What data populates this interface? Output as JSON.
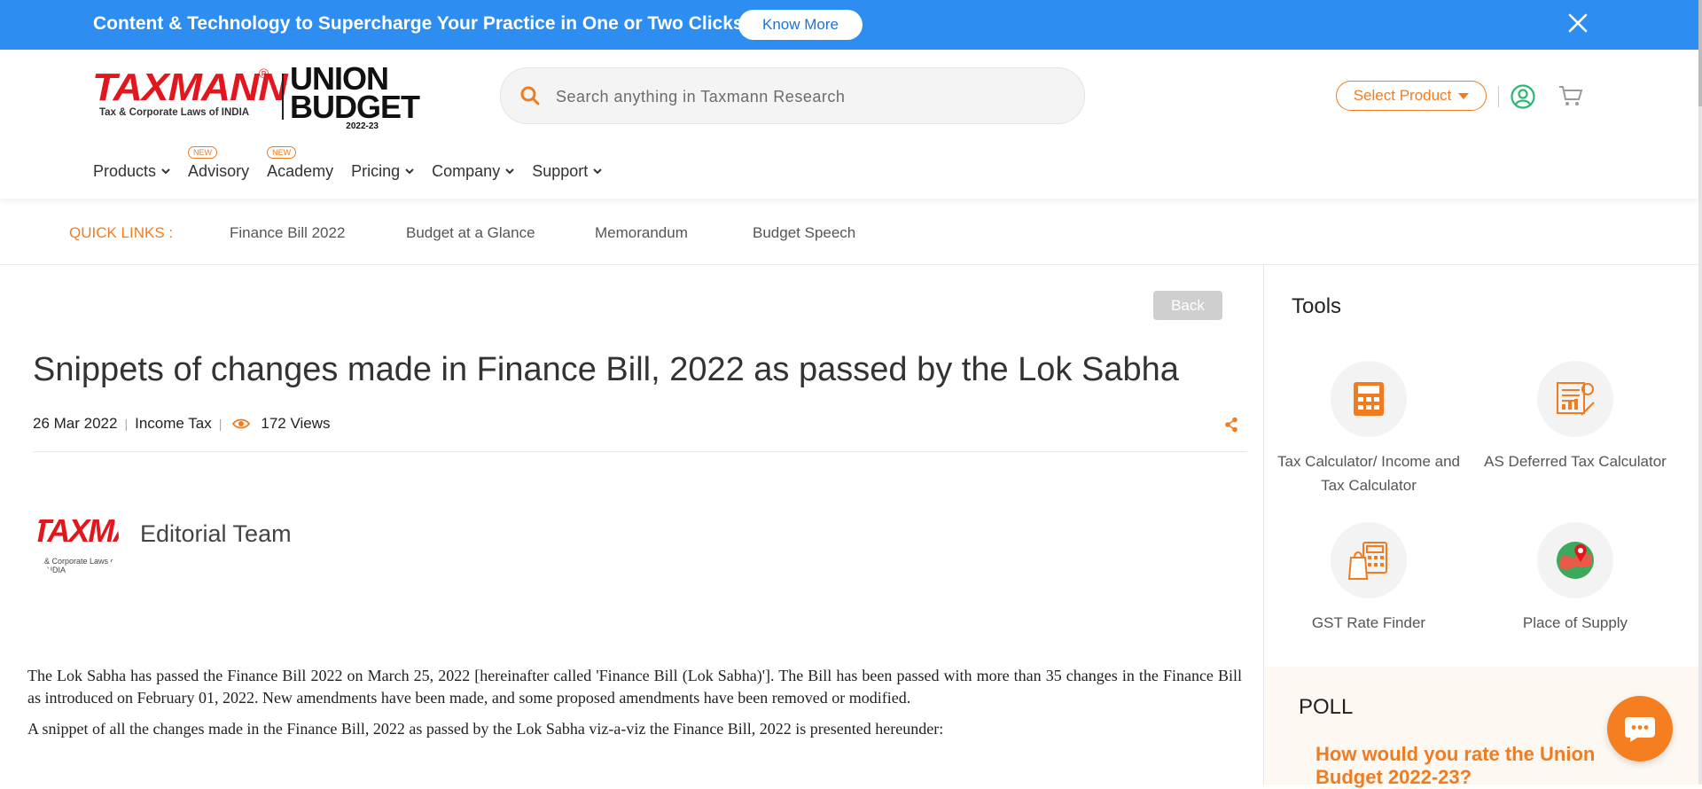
{
  "promo": {
    "text": "Content & Technology to Supercharge Your Practice in One or Two Clicks.",
    "button": "Know More"
  },
  "brand": {
    "logo": "TAXMANN",
    "registered": "®",
    "tagline": "Tax & Corporate Laws of INDIA",
    "budget_line1": "UNION",
    "budget_line2": "BUDGET",
    "budget_year": "2022-23"
  },
  "search": {
    "placeholder": "Search anything in Taxmann Research"
  },
  "header": {
    "select_product": "Select Product"
  },
  "nav": {
    "items": [
      {
        "label": "Products",
        "badge": ""
      },
      {
        "label": "Advisory",
        "badge": "NEW"
      },
      {
        "label": "Academy",
        "badge": "NEW"
      },
      {
        "label": "Pricing",
        "badge": ""
      },
      {
        "label": "Company",
        "badge": ""
      },
      {
        "label": "Support",
        "badge": ""
      }
    ]
  },
  "quick_links": {
    "label": "QUICK LINKS :",
    "links": [
      "Finance Bill 2022",
      "Budget at a Glance",
      "Memorandum",
      "Budget Speech"
    ]
  },
  "article": {
    "back": "Back",
    "title": "Snippets of changes made in Finance Bill, 2022 as passed by the Lok Sabha",
    "date": "26 Mar 2022",
    "category": "Income Tax",
    "views": "172 Views",
    "author_logo_main": "TAXMANN",
    "author_logo_sub": "& Corporate Laws of INDIA",
    "author": "Editorial Team",
    "paragraphs": [
      "The Lok Sabha has passed the Finance Bill 2022 on March 25, 2022 [hereinafter called 'Finance Bill (Lok Sabha)']. The Bill has been passed with more than 35 changes in the Finance Bill as introduced on February 01, 2022. New amendments have been made, and some proposed amendments have been removed or modified.",
      "A snippet of all the changes made in the Finance Bill, 2022 as passed by the Lok Sabha viz-a-viz the Finance Bill, 2022 is presented hereunder:"
    ]
  },
  "sidebar": {
    "tools_title": "Tools",
    "tools": [
      {
        "label": "Tax Calculator/ Income and Tax Calculator",
        "icon": "calculator-icon"
      },
      {
        "label": "AS Deferred Tax Calculator",
        "icon": "deferred-tax-icon"
      },
      {
        "label": "GST Rate Finder",
        "icon": "gst-rate-icon"
      },
      {
        "label": "Place of Supply",
        "icon": "map-pin-icon"
      }
    ],
    "poll_title": "POLL",
    "poll_question": "How would you rate the Union Budget 2022-23?"
  },
  "colors": {
    "accent": "#f07c22",
    "promo_bg": "#2e8df0",
    "brand_red": "#e3161d",
    "user_icon": "#2bb673"
  }
}
